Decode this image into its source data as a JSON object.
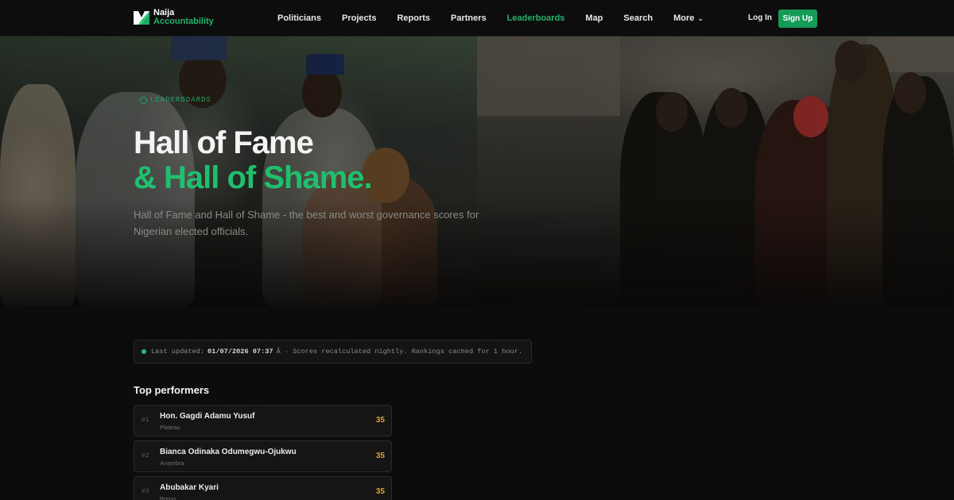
{
  "brand": {
    "line1": "Naija",
    "line2": "Accountability"
  },
  "nav": {
    "items": [
      {
        "label": "Politicians"
      },
      {
        "label": "Projects"
      },
      {
        "label": "Reports"
      },
      {
        "label": "Partners"
      },
      {
        "label": "Leaderboards"
      },
      {
        "label": "Map"
      },
      {
        "label": "Search"
      },
      {
        "label": "More"
      }
    ],
    "login_label": "Log In",
    "signup_label": "Sign Up"
  },
  "hero": {
    "badge": "LEADERBOARDS",
    "title_line1": "Hall of Fame",
    "title_line2": "& Hall of Shame.",
    "subtitle": "Hall of Fame and Hall of Shame - the best and worst governance scores for Nigerian elected officials."
  },
  "status": {
    "prefix": "Last updated:",
    "timestamp": "01/07/2026 07:37",
    "suffix": "Â · Scores recalculated nightly. Rankings cached for 1 hour."
  },
  "top_performers": {
    "title": "Top performers",
    "rows": [
      {
        "rank": "#1",
        "name": "Hon. Gagdi Adamu Yusuf",
        "state": "Plateau",
        "score": "35"
      },
      {
        "rank": "#2",
        "name": "Bianca Odinaka Odumegwu-Ojukwu",
        "state": "Anambra",
        "score": "35"
      },
      {
        "rank": "#3",
        "name": "Abubakar Kyari",
        "state": "Borno",
        "score": "35"
      }
    ]
  },
  "colors": {
    "accent": "#1fbf6e",
    "score": "#e0a03a",
    "background": "#0c0c0c"
  }
}
